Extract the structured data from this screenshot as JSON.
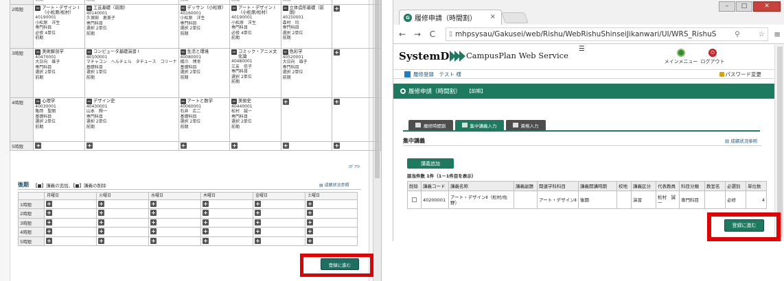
{
  "left": {
    "top_table": [
      {
        "period": "",
        "cells": [
          {
            "lines": [
              "前期"
            ]
          },
          {
            "lines": [
              "前期"
            ]
          },
          {
            "lines": [
              "前期"
            ]
          },
          {
            "lines": [
              "前期"
            ]
          },
          {
            "lines": [
              "前期"
            ]
          },
          {
            "lines": []
          }
        ]
      },
      {
        "period": "2時限",
        "cells": [
          {
            "title": "アート・デザイン I（小松原/松村）",
            "lines": [
              "40190001",
              "小松原　洋生",
              "専門科目",
              "必修 4単位",
              "前期"
            ]
          },
          {
            "title": "工芸基礎（前期）",
            "lines": [
              "40140001",
              "久保田　恵美子",
              "専門科目",
              "選択 2単位",
              "前期"
            ]
          },
          {
            "title": "デッサン（小松原）",
            "lines": [
              "40160001",
              "小松原　洋生",
              "専門科目",
              "選択 2単位",
              "前期"
            ]
          },
          {
            "title": "アート・デザイン I（小松原/松村）",
            "lines": [
              "40190001",
              "小松原　洋生",
              "専門科目",
              "必修 4単位",
              "前期"
            ]
          },
          {
            "title": "立体造形基礎（前期）",
            "lines": [
              "40150001",
              "森村　均",
              "専門科目",
              "選択 2単位",
              "前期"
            ]
          },
          {
            "plus": true
          }
        ]
      },
      {
        "period": "3時限",
        "cells": [
          {
            "title": "美術解剖学",
            "lines": [
              "40470001",
              "大日向　雄子",
              "専門科目",
              "選択 2単位",
              "前期"
            ]
          },
          {
            "title": "コンピュータ基礎演習 I",
            "lines": [
              "40100001",
              "マチャコン　ヘルチェル　タチュース　コリーナ",
              "基礎科目",
              "選択 1単位",
              "前期"
            ]
          },
          {
            "title": "生活と環境",
            "lines": [
              "40080001",
              "橋爪　博幸",
              "基礎科目",
              "選択 2単位",
              "前期"
            ]
          },
          {
            "title": "コミック・アニメ文化論",
            "lines": [
              "40480001",
              "三友　信子",
              "専門科目",
              "選択 2単位",
              "前期"
            ]
          },
          {
            "title": "色彩学",
            "lines": [
              "40520001",
              "大日向　雄子",
              "専門科目",
              "選択 2単位",
              "前期"
            ]
          },
          {
            "plus": true
          }
        ]
      },
      {
        "period": "4時限",
        "cells": [
          {
            "title": "心理学",
            "lines": [
              "40030001",
              "亀岡　聖朗",
              "基礎科目",
              "選択 2単位",
              "前期"
            ]
          },
          {
            "title": "デザイン史",
            "lines": [
              "40430001",
              "山本　輝一",
              "専門科目",
              "選択 2単位",
              "前期"
            ]
          },
          {
            "title": "アートと数学",
            "lines": [
              "40060001",
              "石井　広二",
              "基礎科目",
              "選択 2単位",
              "前期"
            ]
          },
          {
            "title": "美術史",
            "lines": [
              "40440001",
              "松村　誠一",
              "専門科目",
              "選択 2単位",
              "前期"
            ]
          },
          {
            "plus": true
          },
          {
            "plus": true
          }
        ]
      },
      {
        "period": "5時限",
        "cells": [
          {
            "plus": true
          },
          {
            "plus": true
          },
          {
            "plus": true
          },
          {
            "plus": true
          },
          {
            "plus": true
          },
          {
            "plus": true
          }
        ]
      }
    ],
    "small_link": "ﾛｸﾞｱｳﾄ",
    "bottom_title": "後期",
    "bottom_legend": "【■】講義の追加、【■】講義の削除",
    "bottom_link": "成績状況参照",
    "days": [
      "月曜日",
      "火曜日",
      "水曜日",
      "木曜日",
      "金曜日",
      "土曜日"
    ],
    "periods": [
      "1時限",
      "2時限",
      "3時限",
      "4時限",
      "5時限"
    ],
    "next_button": "登録に進む"
  },
  "browser": {
    "tab_title": "履修申請（時間割）",
    "tab_close": "×",
    "url": "mhpsysau/Gakusei/web/Rishu/WebRishuShinseiJikanwari/UI/WRS_RishuS",
    "win_min": "–",
    "win_max": "□",
    "win_close": "✕",
    "back": "←",
    "forward": "→",
    "reload": "C",
    "menu": "≡"
  },
  "page": {
    "logo_text": "SystemD",
    "brand": "CampusPlan Web Service",
    "main_menu": "メインメニュー",
    "logout": "ログアウト",
    "user_label": "履修登録　テスト 様",
    "password_change": "パスワード変更",
    "section_title": "履修申請（時間割）",
    "term": "【前期】",
    "tabs": [
      {
        "label": "履修時間割",
        "active": false
      },
      {
        "label": "集中講義入力",
        "active": true
      },
      {
        "label": "資格入力",
        "active": false
      }
    ],
    "subtitle": "集中講義",
    "seiseki_link": "成績状況参照",
    "add_button": "講義追加",
    "count_text": "該当件数 1件（1－1件目を表示）",
    "table_headers": [
      "削除",
      "講義コード",
      "講義名称",
      "講義副題",
      "関連学科科目",
      "講義開講時期",
      "校地",
      "講義区分",
      "代表教員",
      "科目分類",
      "教室名",
      "必選別",
      "単位数"
    ],
    "rows": [
      [
        "",
        "40200001",
        "アート・デザインⅡ（松村/佐野）",
        "",
        "アート・デザインⅡ",
        "後期",
        "",
        "演習",
        "松村　誠一",
        "専門科目",
        "",
        "必修",
        "4"
      ]
    ],
    "next_button": "登録に進む"
  }
}
